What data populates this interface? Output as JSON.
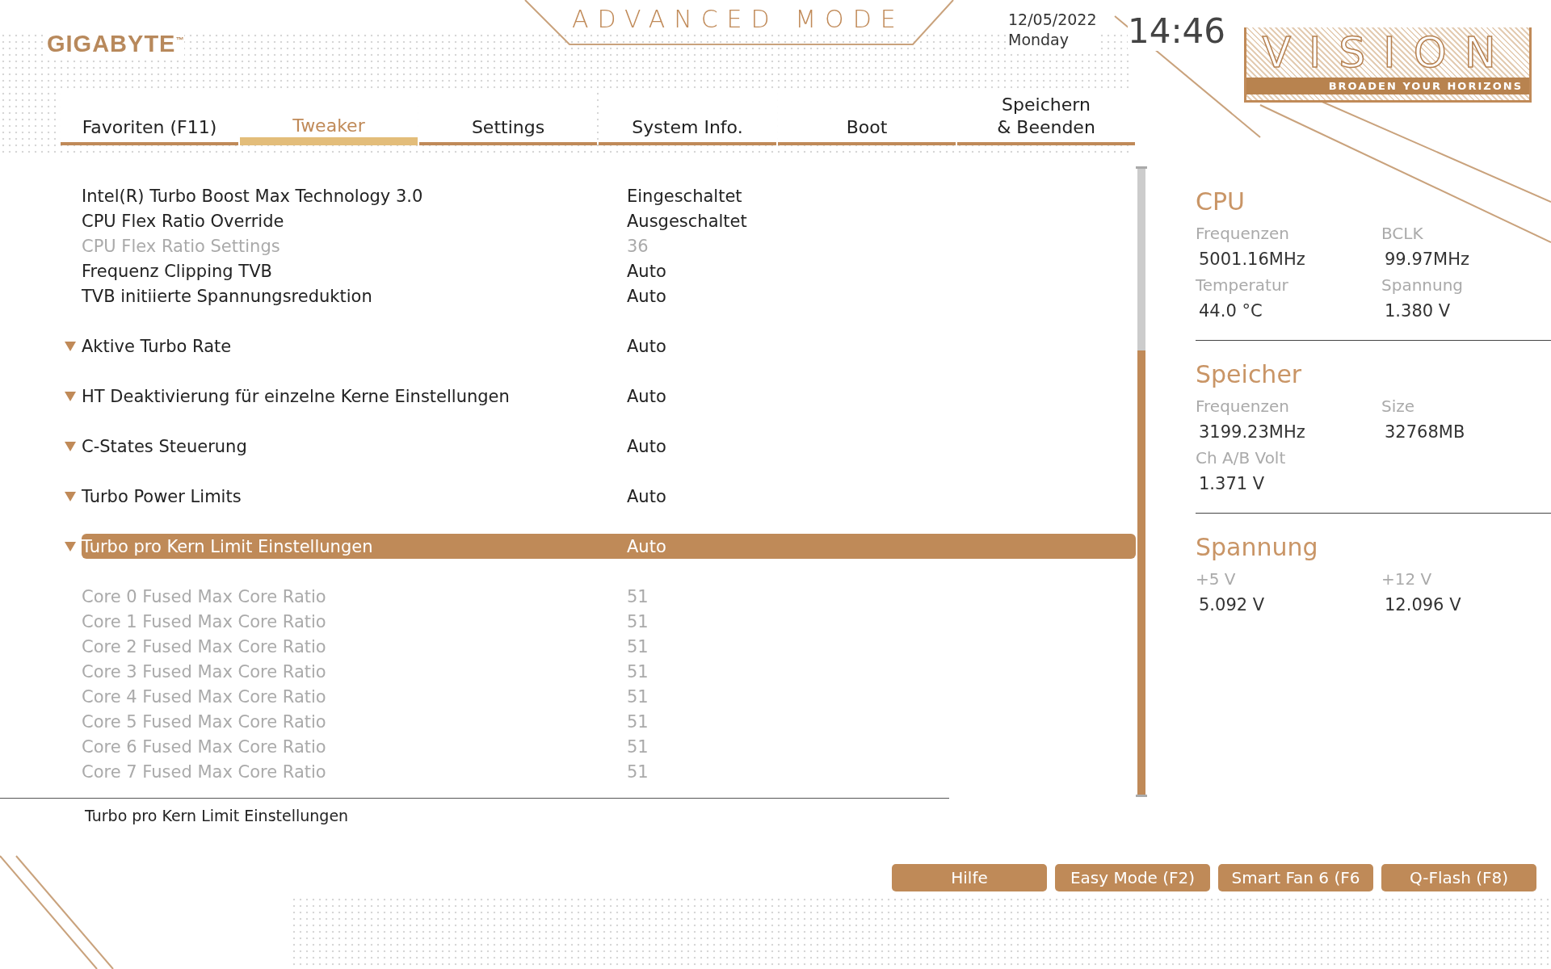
{
  "brand": "GIGABYTE",
  "trademark": "™",
  "mode_title": "ADVANCED MODE",
  "date": "12/05/2022",
  "weekday": "Monday",
  "time": "14:46",
  "vision_logo": {
    "title": "VISION",
    "tagline": "BROADEN YOUR HORIZONS"
  },
  "tabs": [
    {
      "label": "Favoriten (F11)",
      "selected": false
    },
    {
      "label": "Tweaker",
      "selected": true
    },
    {
      "label": "Settings",
      "selected": false
    },
    {
      "label": "System Info.",
      "selected": false
    },
    {
      "label": "Boot",
      "selected": false
    },
    {
      "label": "Speichern\n& Beenden",
      "selected": false
    }
  ],
  "setting_groups": [
    {
      "items": [
        {
          "kind": "setting",
          "label": "Intel(R) Turbo Boost Max Technology 3.0",
          "value": "Eingeschaltet",
          "disabled": false,
          "selected": false
        },
        {
          "kind": "setting",
          "label": "CPU Flex Ratio Override",
          "value": "Ausgeschaltet",
          "disabled": false,
          "selected": false
        },
        {
          "kind": "setting",
          "label": "CPU Flex Ratio Settings",
          "value": "36",
          "disabled": true,
          "selected": false
        },
        {
          "kind": "setting",
          "label": "Frequenz Clipping TVB",
          "value": "Auto",
          "disabled": false,
          "selected": false
        },
        {
          "kind": "setting",
          "label": "TVB initiierte Spannungsreduktion",
          "value": "Auto",
          "disabled": false,
          "selected": false
        }
      ]
    },
    {
      "items": [
        {
          "kind": "submenu",
          "label": "Aktive Turbo Rate",
          "value": "Auto",
          "disabled": false,
          "selected": false
        }
      ]
    },
    {
      "items": [
        {
          "kind": "submenu",
          "label": "HT Deaktivierung für einzelne Kerne Einstellungen",
          "value": "Auto",
          "disabled": false,
          "selected": false
        }
      ]
    },
    {
      "items": [
        {
          "kind": "submenu",
          "label": "C-States Steuerung",
          "value": "Auto",
          "disabled": false,
          "selected": false
        }
      ]
    },
    {
      "items": [
        {
          "kind": "submenu",
          "label": "Turbo Power Limits",
          "value": "Auto",
          "disabled": false,
          "selected": false
        }
      ]
    },
    {
      "items": [
        {
          "kind": "submenu",
          "label": "Turbo pro Kern Limit Einstellungen",
          "value": "Auto",
          "disabled": false,
          "selected": true
        }
      ]
    },
    {
      "items": [
        {
          "kind": "setting",
          "label": "Core 0 Fused Max Core Ratio",
          "value": "51",
          "disabled": true,
          "selected": false
        },
        {
          "kind": "setting",
          "label": "Core 1 Fused Max Core Ratio",
          "value": "51",
          "disabled": true,
          "selected": false
        },
        {
          "kind": "setting",
          "label": "Core 2 Fused Max Core Ratio",
          "value": "51",
          "disabled": true,
          "selected": false
        },
        {
          "kind": "setting",
          "label": "Core 3 Fused Max Core Ratio",
          "value": "51",
          "disabled": true,
          "selected": false
        },
        {
          "kind": "setting",
          "label": "Core 4 Fused Max Core Ratio",
          "value": "51",
          "disabled": true,
          "selected": false
        },
        {
          "kind": "setting",
          "label": "Core 5 Fused Max Core Ratio",
          "value": "51",
          "disabled": true,
          "selected": false
        },
        {
          "kind": "setting",
          "label": "Core 6 Fused Max Core Ratio",
          "value": "51",
          "disabled": true,
          "selected": false
        },
        {
          "kind": "setting",
          "label": "Core 7 Fused Max Core Ratio",
          "value": "51",
          "disabled": true,
          "selected": false
        }
      ]
    }
  ],
  "help_text": "Turbo pro Kern Limit Einstellungen",
  "monitor": [
    {
      "title": "CPU",
      "fields": [
        {
          "label": "Frequenzen",
          "value": "5001.16MHz"
        },
        {
          "label": "BCLK",
          "value": "99.97MHz"
        },
        {
          "label": "Temperatur",
          "value": "44.0 °C"
        },
        {
          "label": "Spannung",
          "value": "1.380 V"
        }
      ]
    },
    {
      "title": "Speicher",
      "fields": [
        {
          "label": "Frequenzen",
          "value": "3199.23MHz"
        },
        {
          "label": "Size",
          "value": "32768MB"
        },
        {
          "label": "Ch A/B Volt",
          "value": "1.371 V"
        }
      ]
    },
    {
      "title": "Spannung",
      "fields": [
        {
          "label": "+5 V",
          "value": "5.092 V"
        },
        {
          "label": "+12 V",
          "value": "12.096 V"
        }
      ]
    }
  ],
  "buttons": [
    "Hilfe",
    "Easy Mode (F2)",
    "Smart Fan 6 (F6",
    "Q-Flash (F8)"
  ]
}
